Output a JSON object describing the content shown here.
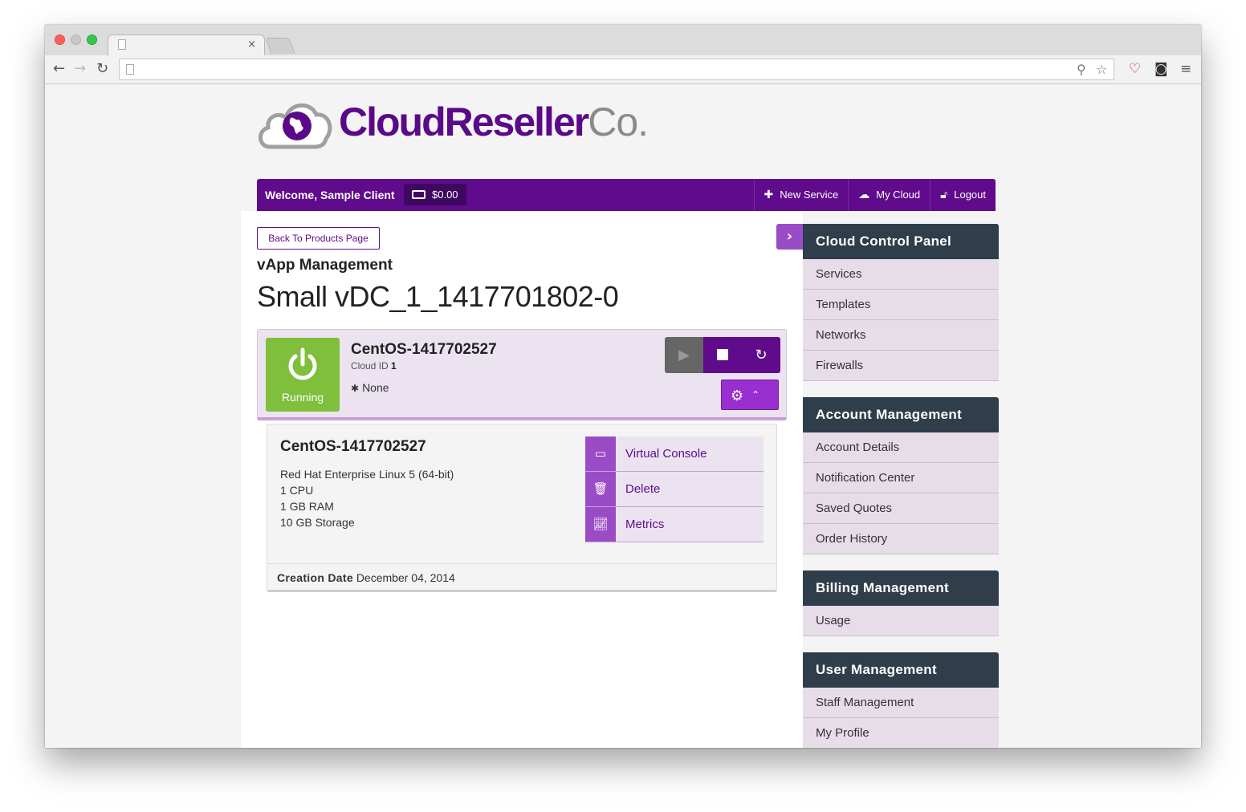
{
  "browser": {
    "tab_close": "×",
    "back": "←",
    "forward": "→",
    "reload": "↻"
  },
  "brand": {
    "name": "CloudReseller",
    "suffix": "Co."
  },
  "topbar": {
    "welcome": "Welcome, Sample Client",
    "balance": "$0.00",
    "nav": [
      {
        "label": "New Service",
        "icon": "plus-icon"
      },
      {
        "label": "My Cloud",
        "icon": "cloud-icon"
      },
      {
        "label": "Logout",
        "icon": "unlock-icon"
      }
    ]
  },
  "main": {
    "back_button": "Back To Products Page",
    "section_label": "vApp Management",
    "vapp_name": "Small vDC_1_1417701802-0"
  },
  "vm": {
    "status": "Running",
    "name": "CentOS-1417702527",
    "cloud_id_label": "Cloud ID",
    "cloud_id": "1",
    "meta": "None",
    "os": "Red Hat Enterprise Linux 5 (64-bit)",
    "cpu": "1 CPU",
    "ram": "1 GB RAM",
    "storage": "10 GB Storage",
    "creation_label": "Creation Date",
    "creation_date": "December 04, 2014",
    "actions": [
      {
        "label": "Virtual Console",
        "icon": "laptop-icon"
      },
      {
        "label": "Delete",
        "icon": "trash-icon"
      },
      {
        "label": "Metrics",
        "icon": "chart-icon"
      }
    ]
  },
  "sidebar": {
    "groups": [
      {
        "title": "Cloud Control Panel",
        "items": [
          "Services",
          "Templates",
          "Networks",
          "Firewalls"
        ]
      },
      {
        "title": "Account Management",
        "items": [
          "Account Details",
          "Notification Center",
          "Saved Quotes",
          "Order History"
        ]
      },
      {
        "title": "Billing Management",
        "items": [
          "Usage"
        ]
      },
      {
        "title": "User Management",
        "items": [
          "Staff Management",
          "My Profile"
        ]
      }
    ]
  },
  "colors": {
    "brand_purple": "#5f0b8b",
    "accent_purple": "#9a4cc7",
    "status_green": "#7fbf3b",
    "sidebar_head": "#2f3e4a"
  }
}
